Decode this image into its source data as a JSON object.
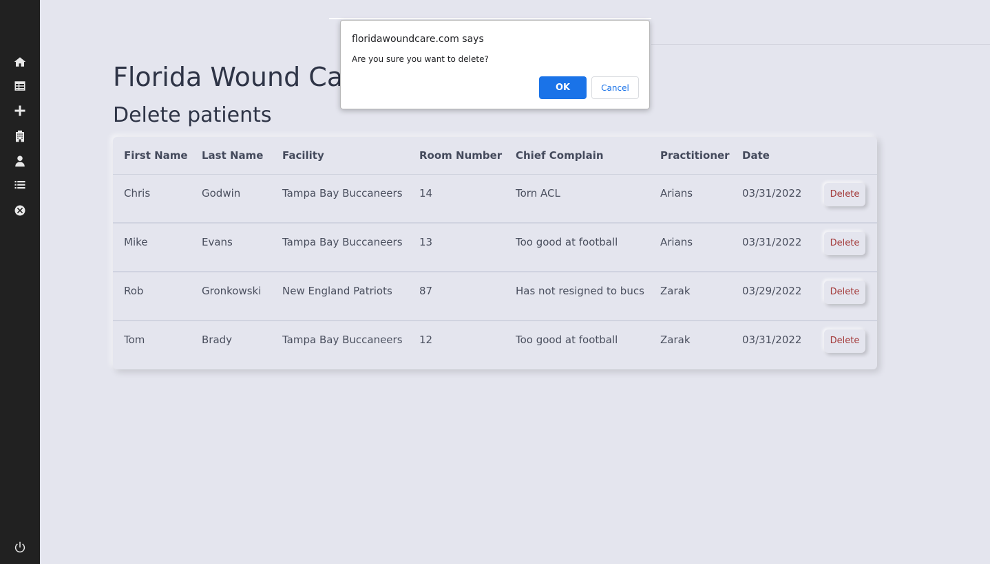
{
  "sidebar": {
    "icons": [
      "home-icon",
      "table-icon",
      "plus-icon",
      "hospital-icon",
      "doctor-icon",
      "list-icon",
      "close-circle-icon"
    ],
    "bottom_icon": "power-icon"
  },
  "header": {
    "title": "Florida Wound Car",
    "subtitle": "Delete patients"
  },
  "table": {
    "columns": [
      "First Name",
      "Last Name",
      "Facility",
      "Room Number",
      "Chief Complain",
      "Practitioner",
      "Date"
    ],
    "delete_label": "Delete",
    "rows": [
      {
        "first": "Chris",
        "last": "Godwin",
        "facility": "Tampa Bay Buccaneers",
        "room": "14",
        "complaint": "Torn ACL",
        "practitioner": "Arians",
        "date": "03/31/2022"
      },
      {
        "first": "Mike",
        "last": "Evans",
        "facility": "Tampa Bay Buccaneers",
        "room": "13",
        "complaint": "Too good at football",
        "practitioner": "Arians",
        "date": "03/31/2022"
      },
      {
        "first": "Rob",
        "last": "Gronkowski",
        "facility": "New England Patriots",
        "room": "87",
        "complaint": "Has not resigned to bucs",
        "practitioner": "Zarak",
        "date": "03/29/2022"
      },
      {
        "first": "Tom",
        "last": "Brady",
        "facility": "Tampa Bay Buccaneers",
        "room": "12",
        "complaint": "Too good at football",
        "practitioner": "Zarak",
        "date": "03/31/2022"
      }
    ]
  },
  "dialog": {
    "title": "floridawoundcare.com says",
    "message": "Are you sure you want to delete?",
    "ok_label": "OK",
    "cancel_label": "Cancel"
  },
  "colors": {
    "sidebar_bg": "#212121",
    "page_bg": "#e4e5ee",
    "delete_text": "#a33a3a",
    "ok_button": "#1a73e8"
  }
}
